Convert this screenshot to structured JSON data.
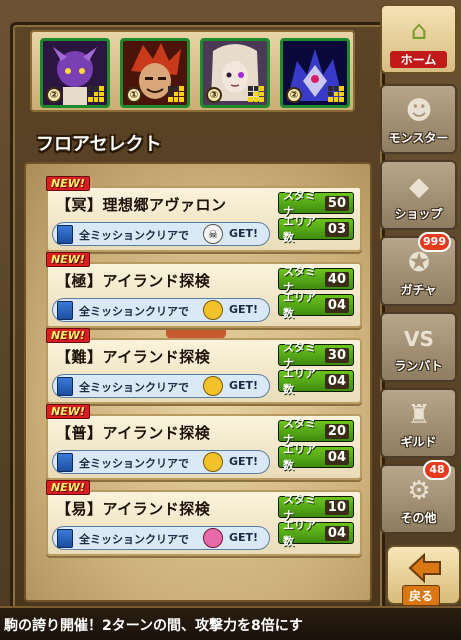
{
  "party": {
    "members": [
      {
        "level_mark": "②",
        "frame": "#1e8a2c",
        "portrait_colors": [
          "#7a3fb2",
          "#2b163f"
        ],
        "name_icon": "dark-knight-portrait-icon"
      },
      {
        "level_mark": "①",
        "frame": "#1e8a2c",
        "portrait_colors": [
          "#c83a1a",
          "#4a140a"
        ],
        "name_icon": "fire-warrior-portrait-icon"
      },
      {
        "level_mark": "③",
        "frame": "#1e8a2c",
        "portrait_colors": [
          "#e7dccb",
          "#4a3a56"
        ],
        "name_icon": "silver-maiden-portrait-icon"
      },
      {
        "level_mark": "②",
        "frame": "#1e8a2c",
        "portrait_colors": [
          "#3a3ac8",
          "#0a0a3a"
        ],
        "name_icon": "void-beast-portrait-icon"
      }
    ],
    "leader_icon": "crown-icon"
  },
  "floor_select_title": "フロアセレクト",
  "floors": [
    {
      "badge": "NEW!",
      "name": "【冥】理想郷アヴァロン",
      "mission_text": "全ミッションクリアで",
      "get_label": "GET!",
      "reward_icon": "white-skull-reward-icon",
      "stamina_label": "スタミナ",
      "stamina_value": "50",
      "area_label": "エリア数",
      "area_value": "03"
    },
    {
      "badge": "NEW!",
      "name": "【極】アイランド探検",
      "mission_text": "全ミッションクリアで",
      "get_label": "GET!",
      "reward_icon": "gold-orb-reward-icon",
      "stamina_label": "スタミナ",
      "stamina_value": "40",
      "area_label": "エリア数",
      "area_value": "04"
    },
    {
      "badge": "NEW!",
      "name": "【難】アイランド探検",
      "mission_text": "全ミッションクリアで",
      "get_label": "GET!",
      "reward_icon": "gold-orb-reward-icon",
      "stamina_label": "スタミナ",
      "stamina_value": "30",
      "area_label": "エリア数",
      "area_value": "04"
    },
    {
      "badge": "NEW!",
      "name": "【普】アイランド探検",
      "mission_text": "全ミッションクリアで",
      "get_label": "GET!",
      "reward_icon": "gold-orb-reward-icon",
      "stamina_label": "スタミナ",
      "stamina_value": "20",
      "area_label": "エリア数",
      "area_value": "04"
    },
    {
      "badge": "NEW!",
      "name": "【易】アイランド探検",
      "mission_text": "全ミッションクリアで",
      "get_label": "GET!",
      "reward_icon": "pink-creature-reward-icon",
      "stamina_label": "スタミナ",
      "stamina_value": "10",
      "area_label": "エリア数",
      "area_value": "04"
    }
  ],
  "sidebar": {
    "items": [
      {
        "label": "ホーム",
        "icon": "home-icon",
        "badge": ""
      },
      {
        "label": "モンスター",
        "icon": "monster-icon",
        "badge": ""
      },
      {
        "label": "ショップ",
        "icon": "shop-icon",
        "badge": ""
      },
      {
        "label": "ガチャ",
        "icon": "gacha-icon",
        "badge": "999"
      },
      {
        "label": "ランバト",
        "icon": "versus-icon",
        "badge": ""
      },
      {
        "label": "ギルド",
        "icon": "guild-icon",
        "badge": ""
      },
      {
        "label": "その他",
        "icon": "gear-icon",
        "badge": "48"
      }
    ]
  },
  "back_button": {
    "label": "戻る"
  },
  "ticker": {
    "text": "駒の誇り開催！2ターンの間、攻撃力を8倍にす"
  },
  "colors": {
    "stamina_green": "#6cc51c",
    "new_badge_red": "#d81e1e",
    "home_label_red": "#c21a1a",
    "badge_red": "#e53c1e"
  }
}
